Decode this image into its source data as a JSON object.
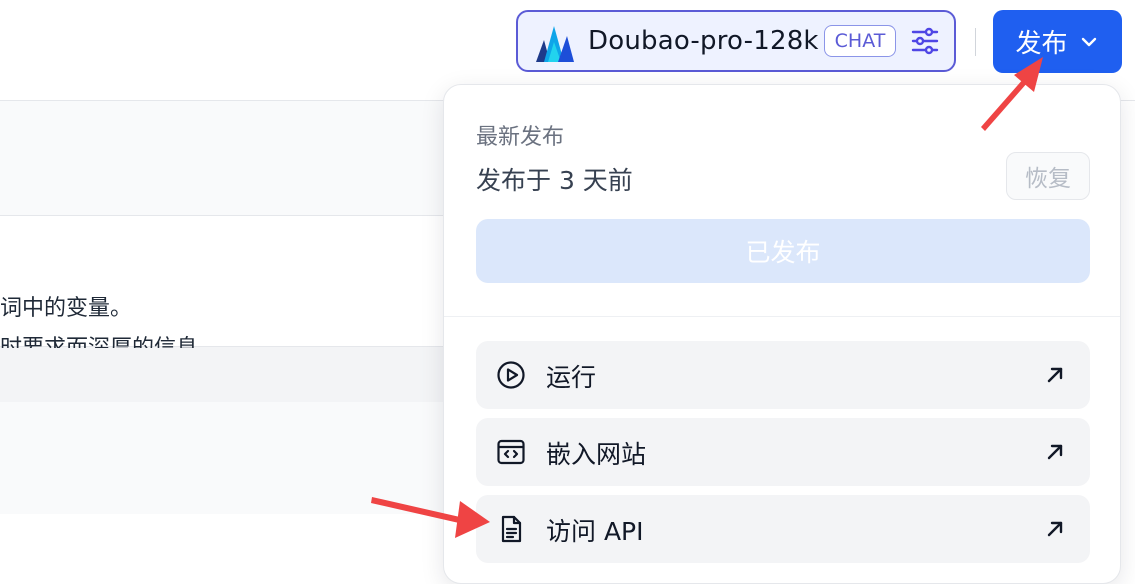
{
  "header": {
    "model_name": "Doubao-pro-128k",
    "model_badge": "CHAT",
    "publish_label": "发布"
  },
  "background": {
    "line1": "词中的变量。",
    "line2": "时要求而深厚的信息。"
  },
  "publish_menu": {
    "section_label": "最新发布",
    "published_time": "发布于 3 天前",
    "restore_label": "恢复",
    "published_status": "已发布",
    "actions": [
      {
        "label": "运行",
        "icon": "play-circle-icon"
      },
      {
        "label": "嵌入网站",
        "icon": "embed-code-icon"
      },
      {
        "label": "访问 API",
        "icon": "document-icon"
      }
    ]
  },
  "colors": {
    "primary": "#1f5ff0",
    "chip_border": "#5b5bd6",
    "annotation_red": "#ef4444"
  }
}
